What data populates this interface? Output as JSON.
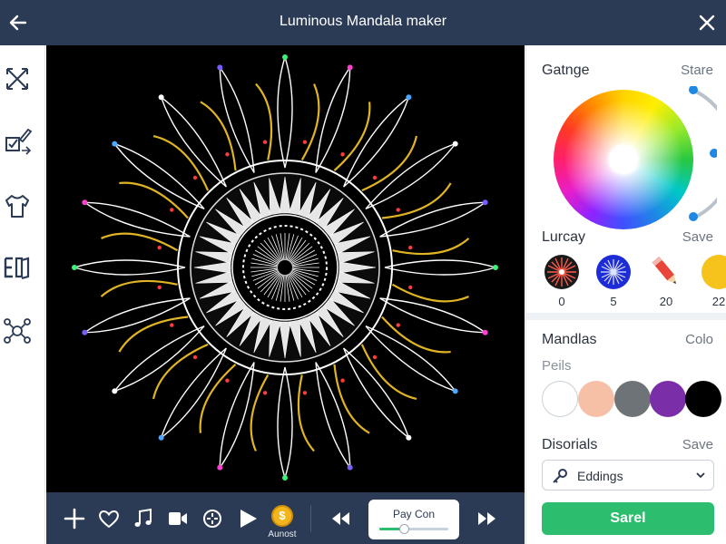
{
  "app": {
    "title": "Luminous Mandala maker"
  },
  "icons": {
    "back": "arrow-left-icon",
    "close": "close-icon",
    "tools": [
      "expand-arrows-icon",
      "checklist-edit-icon",
      "shirt-icon",
      "book-icon",
      "node-network-icon"
    ]
  },
  "player": {
    "buttons": [
      "plus-icon",
      "heart-icon",
      "music-note-icon",
      "video-camera-icon",
      "crosshair-icon",
      "play-icon"
    ],
    "coin_symbol": "$",
    "coin_label": "Aunost",
    "pay_label": "Pay Con",
    "pay_progress": 0.35,
    "rewind_icon": "rewind-icon",
    "forward_icon": "fast-forward-icon"
  },
  "panel": {
    "gradient": {
      "title": "Gatnge",
      "action": "Stare"
    },
    "lucray": {
      "title": "Lurcay",
      "action": "Save",
      "brushes": [
        {
          "value": "0",
          "color": "#e53935"
        },
        {
          "value": "5",
          "color": "#1e3cff"
        },
        {
          "value": "20",
          "color": "#e8463a"
        },
        {
          "value": "22",
          "color": "#f6c21c"
        }
      ]
    },
    "mandalas": {
      "title": "Mandlas",
      "action": "Colo",
      "sub": "Peils",
      "swatches": [
        "#ffffff",
        "#f6c0a6",
        "#6e7377",
        "#7a2fa8",
        "#000000"
      ]
    },
    "disorials": {
      "title": "Disorials",
      "action": "Save",
      "dropdown": "Eddings",
      "button": "Sarel"
    }
  },
  "colors": {
    "topbar": "#2b3a55",
    "accent": "#2dbd6e",
    "canvas": "#000000",
    "gold": "#e0b423"
  }
}
